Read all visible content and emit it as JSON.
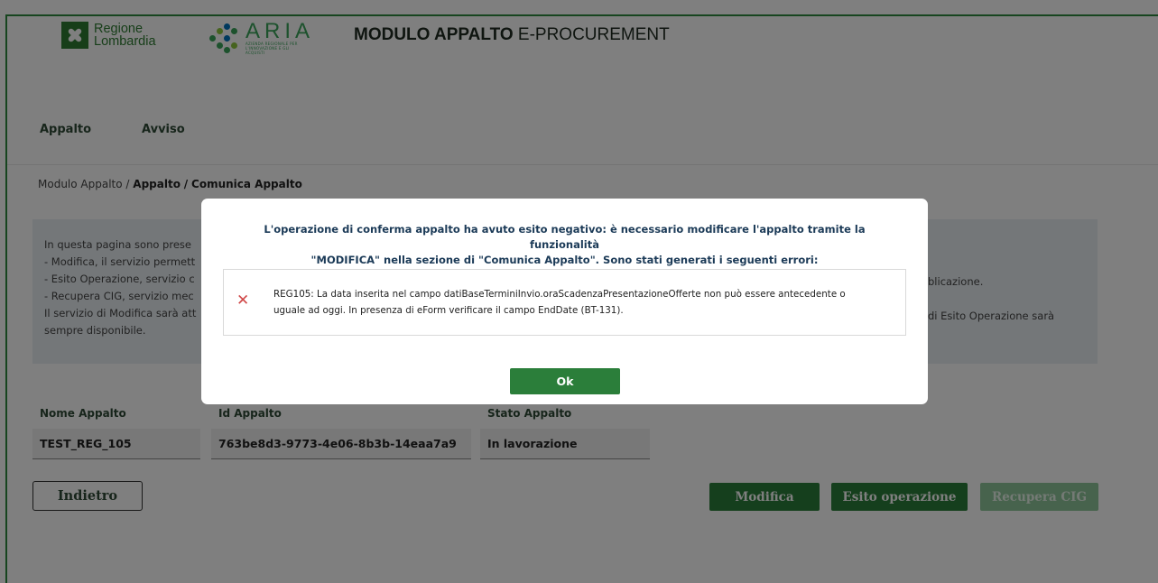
{
  "header": {
    "region_logo_line1": "Regione",
    "region_logo_line2": "Lombardia",
    "aria_logo_word": "ARIA",
    "aria_logo_subtitle": "AZIENDA REGIONALE PER L'INNOVAZIONE E GLI ACQUISTI",
    "title_bold": "MODULO APPALTO",
    "title_regular": "E-PROCUREMENT"
  },
  "nav": {
    "items": [
      {
        "label": "Appalto"
      },
      {
        "label": "Avviso"
      }
    ]
  },
  "breadcrumb": {
    "root": "Modulo Appalto",
    "sep1": "/",
    "section": "Appalto",
    "sep2": "/",
    "current": "Comunica Appalto"
  },
  "info": {
    "line1": "In questa pagina sono prese",
    "line2": "- Modifica, il servizio permett",
    "line3": "- Esito Operazione, servizio c",
    "line4": "- Recupera CIG, servizio mec",
    "line5": "Il servizio di Modifica sarà att",
    "line6": "sempre disponibile.",
    "right1": "blicazione.",
    "right2": "di Esito Operazione sarà"
  },
  "table": {
    "columns": [
      {
        "label": "Nome Appalto",
        "value": "TEST_REG_105"
      },
      {
        "label": "Id Appalto",
        "value": "763be8d3-9773-4e06-8b3b-14eaa7a9"
      },
      {
        "label": "Stato Appalto",
        "value": "In lavorazione"
      }
    ]
  },
  "buttons": {
    "back": "Indietro",
    "modify": "Modifica",
    "outcome": "Esito operazione",
    "retrieve_cig": "Recupera CIG"
  },
  "modal": {
    "title_line1": "L'operazione di conferma appalto ha avuto esito negativo: è necessario modificare l'appalto tramite la funzionalità",
    "title_line2": "\"MODIFICA\" nella sezione di \"Comunica Appalto\". Sono stati generati i seguenti errori:",
    "error_icon": "close-icon",
    "error_line1": "REG105: La data inserita nel campo datiBaseTerminiInvio.oraScadenzaPresentazioneOfferte non può essere antecedente o",
    "error_line2": "uguale ad oggi. In presenza di eForm verificare il campo EndDate (BT-131).",
    "ok_label": "Ok"
  },
  "colors": {
    "brand_green": "#2e7d32",
    "button_green": "#2b7e3a",
    "error_red": "#d04848",
    "info_bg": "#e8eef3"
  }
}
